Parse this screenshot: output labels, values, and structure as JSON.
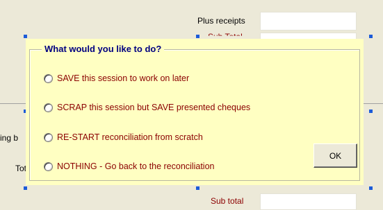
{
  "background": {
    "plus_receipts_label": "Plus receipts",
    "sub_total_partial": "Sub Total",
    "left_cut_label_1": "ing b",
    "left_cut_label_2": "Tot",
    "sub_total_bottom": "Sub total"
  },
  "dialog": {
    "title": "What would you like to do?",
    "options": [
      {
        "label": "SAVE this session to work on later"
      },
      {
        "label": "SCRAP this session but SAVE presented cheques"
      },
      {
        "label": "RE-START reconciliation from scratch"
      },
      {
        "label": "NOTHING - Go back to the reconciliation"
      }
    ],
    "ok_label": "OK"
  },
  "colors": {
    "dialog_background": "#ffffc2",
    "title_color": "#000080",
    "option_text_color": "#8b0000",
    "selection_handle": "#1c5bd8"
  }
}
